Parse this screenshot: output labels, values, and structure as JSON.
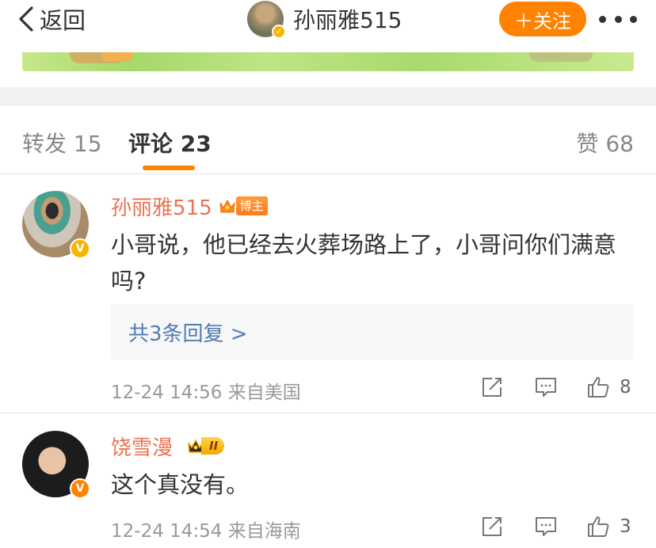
{
  "header": {
    "back_label": "返回",
    "user_name": "孙丽雅515",
    "follow_label": "＋关注"
  },
  "tabs": {
    "repost_label": "转发 15",
    "comment_label": "评论 23",
    "like_label": "赞 68"
  },
  "comments": [
    {
      "name": "孙丽雅515",
      "badge": "博主",
      "text": "小哥说，他已经去火葬场路上了，小哥问你们满意吗?",
      "replies_label": "共3条回复 >",
      "meta": "12-24 14:56 来自美国",
      "likes": "8"
    },
    {
      "name": "饶雪漫",
      "level": "II",
      "text": "这个真没有。",
      "meta": "12-24 14:54 来自海南",
      "likes": "3"
    }
  ],
  "colors": {
    "accent": "#ff8200",
    "name": "#eb7350",
    "link": "#507daf"
  },
  "icons": [
    "chevron-left-icon",
    "more-icon",
    "verified-icon",
    "crown-icon",
    "share-icon",
    "reply-icon",
    "thumbs-up-icon"
  ]
}
